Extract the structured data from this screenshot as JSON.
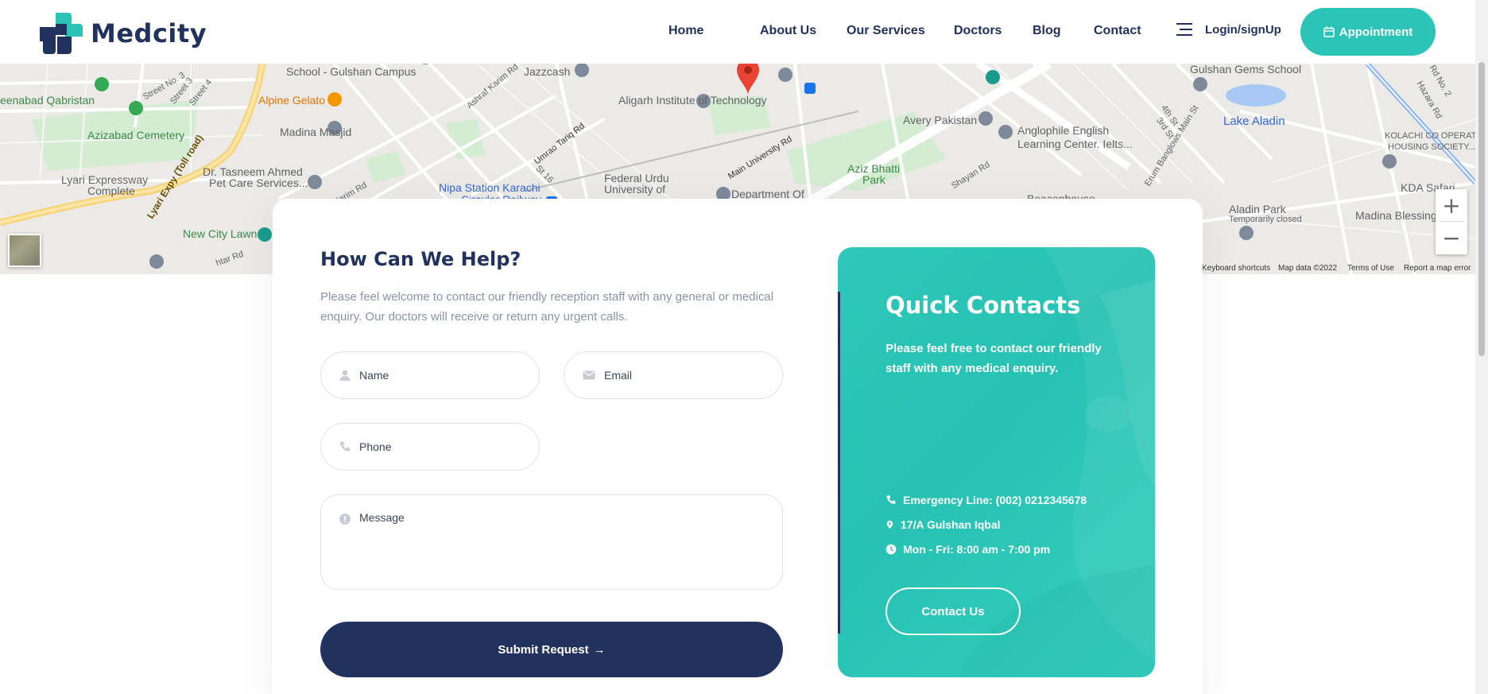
{
  "header": {
    "brand": "Medcity",
    "nav": [
      {
        "label": "Home"
      },
      {
        "label": "About Us"
      },
      {
        "label": "Our Services"
      },
      {
        "label": "Doctors"
      },
      {
        "label": "Blog"
      },
      {
        "label": "Contact"
      }
    ],
    "login_label": "Login/signUp",
    "appointment_label": "Appointment"
  },
  "map": {
    "places": {
      "p1": "School - Gulshan Campus",
      "p2": "Jazzcash",
      "p3": "Gulshan Gems School",
      "p4": "Lake Aladin",
      "p5": "Azizabad Cemetery",
      "p6": "Alpine Gelato",
      "p7": "Madina Masjid",
      "p8": "Aligarh Institute of Technology",
      "p9": "Avery Pakistan",
      "p10": "Anglophile English",
      "p11": "Learning Center. Ielts...",
      "p12": "Aziz Bhatti",
      "p13": "Park",
      "p14": "Lyari Expressway",
      "p15": "Complete",
      "p16": "Dr. Tasneem Ahmed",
      "p17": "Pet Care Services...",
      "p18": "Nipa Station Karachi",
      "p19": "Circular Railway",
      "p20": "Federal Urdu",
      "p21": "University of",
      "p22": "Department Of",
      "p23": "New City Lawn",
      "p24": "Aladin Park",
      "p25": "Temporarily closed",
      "p26": "Madina Blessing",
      "p27": "KDA Safari",
      "p28": "KOLACHI CO OPERATI",
      "p29": "HOUSING SOCIETY...",
      "p30": "Beaconhouse",
      "p31": "eenabad Qabristan",
      "p32": "Lyari Expy (Toll road)",
      "p33": "Umrao Tariq Rd",
      "p34": "Main University Rd",
      "p35": "Ashraf Karim Rd",
      "p36": "Shayan Rd",
      "p37": "Erum Banglows Main St",
      "p38": "4th St",
      "p39": "3rd St",
      "p40": "St 16",
      "p41": "Karim Rd",
      "p42": "Street 3",
      "p43": "Street 4",
      "p44": "Street No. 3",
      "p45": "Hazara Rd",
      "p46": "Rd No. 2",
      "p47": "htar Rd"
    },
    "zoom_in": "+",
    "zoom_out": "−",
    "footer": {
      "shortcuts": "Keyboard shortcuts",
      "map_data": "Map data ©2022",
      "terms": "Terms of Use",
      "report": "Report a map error"
    }
  },
  "contact_form": {
    "title": "How Can We Help?",
    "description": "Please feel welcome to contact our friendly reception staff with any general or medical enquiry. Our doctors will receive or return any urgent calls.",
    "name_placeholder": "Name",
    "email_placeholder": "Email",
    "phone_placeholder": "Phone",
    "message_placeholder": "Message",
    "submit_label": "Submit Request",
    "submit_arrow": "→"
  },
  "quick_contacts": {
    "title": "Quick Contacts",
    "description": "Please feel free to contact our friendly staff with any medical enquiry.",
    "emergency": "Emergency Line: (002) 0212345678",
    "address": "17/A Gulshan Iqbal",
    "hours": "Mon - Fri: 8:00 am - 7:00 pm",
    "button_label": "Contact Us"
  },
  "colors": {
    "navy": "#21325e",
    "teal": "#2bc4b6",
    "muted_text": "#8a93a5",
    "map_pin": "#ea4335"
  }
}
